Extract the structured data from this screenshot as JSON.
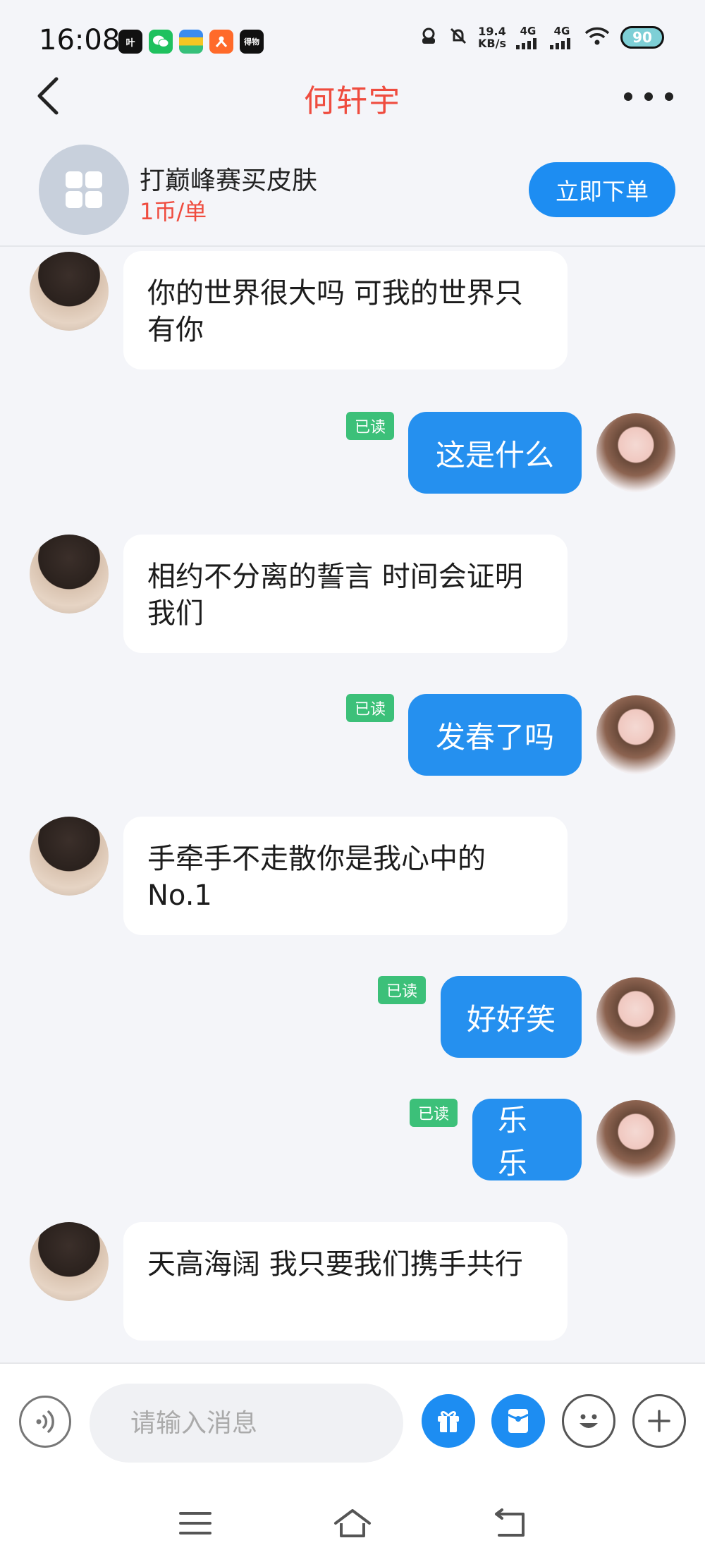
{
  "status_bar": {
    "time": "16:08",
    "net_speed_value": "19.4",
    "net_speed_unit": "KB/s",
    "signal_1": "4G",
    "signal_2": "4G",
    "battery": "90",
    "app_icon_labels": [
      "叶",
      "得物"
    ]
  },
  "header": {
    "title": "何轩宇"
  },
  "order": {
    "name": "打巅峰赛买皮肤",
    "price": "1币/单",
    "button": "立即下单"
  },
  "messages": [
    {
      "side": "in",
      "text": "你的世界很大吗 可我的世界只有你"
    },
    {
      "side": "out",
      "text": "这是什么",
      "read": "已读"
    },
    {
      "side": "in",
      "text": "相约不分离的誓言 时间会证明我们"
    },
    {
      "side": "out",
      "text": "发春了吗",
      "read": "已读"
    },
    {
      "side": "in",
      "text": "手牵手不走散你是我心中的No.1"
    },
    {
      "side": "out",
      "text": "好好笑",
      "read": "已读"
    },
    {
      "side": "out",
      "text": "乐乐",
      "read": "已读"
    },
    {
      "side": "in",
      "text": "天高海阔 我只要我们携手共行"
    }
  ],
  "input": {
    "placeholder": "请输入消息"
  },
  "colors": {
    "accent_blue": "#1d8df2",
    "title_red": "#ef4c3f",
    "read_green": "#3cc079",
    "background": "#f4f5f9"
  },
  "icons": [
    "back-arrow-icon",
    "more-dots-icon",
    "grid-icon",
    "voice-icon",
    "gift-icon",
    "red-packet-icon",
    "emoji-icon",
    "plus-icon",
    "menu-icon",
    "home-icon",
    "back-nav-icon"
  ]
}
